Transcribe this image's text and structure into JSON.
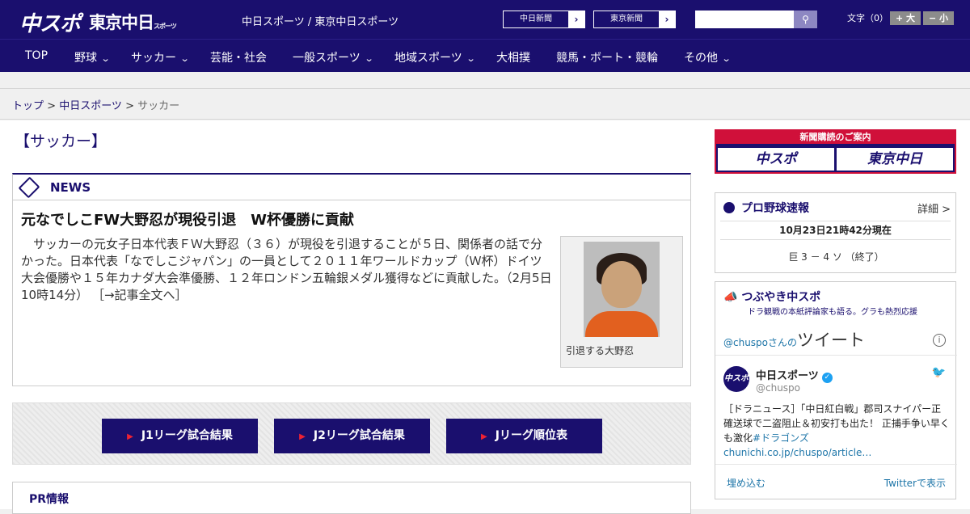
{
  "header": {
    "logo_main": "中スポ",
    "logo_tokyo": "東京中日",
    "logo_tokyo_small": "スポーツ",
    "site_names": "中日スポーツ / 東京中日スポーツ",
    "ext_links": [
      "中日新聞",
      "東京新聞"
    ],
    "fontsize_label": "文字（0）",
    "font_plus": "+ 大",
    "font_minus": "− 小"
  },
  "nav": {
    "items": [
      {
        "label": "TOP"
      },
      {
        "label": "野球"
      },
      {
        "label": "サッカー"
      },
      {
        "label": "芸能・社会"
      },
      {
        "label": "一般スポーツ"
      },
      {
        "label": "地域スポーツ"
      },
      {
        "label": "大相撲"
      },
      {
        "label": "競馬・ボート・競輪"
      },
      {
        "label": "その他"
      }
    ]
  },
  "breadcrumb": {
    "items": [
      "トップ",
      "中日スポーツ",
      "サッカー"
    ],
    "sep": " > "
  },
  "section_title": "【サッカー】",
  "news": {
    "label": "NEWS",
    "headline": "元なでしこFW大野忍が現役引退　W杯優勝に貢献",
    "body": "　サッカーの元女子日本代表ＦＷ大野忍（３６）が現役を引退することが５日、関係者の話で分かった。日本代表「なでしこジャパン」の一員として２０１１年ワールドカップ（Ｗ杯）ドイツ大会優勝や１５年カナダ大会準優勝、１２年ロンドン五輪銀メダル獲得などに貢献した。（2月5日 10時14分）",
    "more": "［→記事全文へ］",
    "photo_caption": "引退する大野忍"
  },
  "results": {
    "buttons": [
      "J1リーグ試合結果",
      "J2リーグ試合結果",
      "Jリーグ順位表"
    ]
  },
  "pr_label": "PR情報",
  "subscribe": {
    "title": "新聞購読のご案内",
    "left": "中スポ",
    "right": "東京中日"
  },
  "baseball": {
    "title": "プロ野球速報",
    "detail": "詳細 >",
    "time": "10月23日21時42分現在",
    "score": "巨 3 － 4 ソ （終了）"
  },
  "tweets": {
    "title": "つぶやき中スポ",
    "subtitle": "ドラ観戦の本紙評論家も語る。グラも熱烈応援",
    "handle_prefix": "@chuspo",
    "handle_suffix": "さんの",
    "tweets_label": "ツイート",
    "info": "i",
    "avatar": "中スポ",
    "name": "中日スポーツ",
    "verified": "✓",
    "user": "@chuspo",
    "text": "［ドラニュース］「中日紅白戦」郡司スナイパー正確送球で二盗阻止＆初安打も出た！ 正捕手争い早くも激化",
    "tag": "#ドラゴンズchunichi.co.jp/chuspo/article…",
    "embed": "埋め込む",
    "view": "Twitterで表示"
  },
  "colors": {
    "brand": "#1a0f6e",
    "accent": "#d0103a",
    "link": "#1d75a8"
  }
}
